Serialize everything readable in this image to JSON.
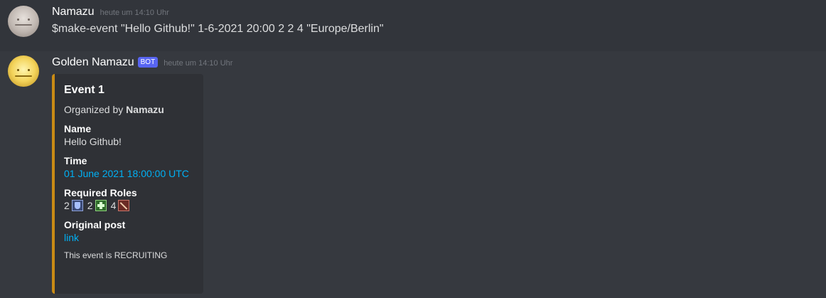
{
  "messages": [
    {
      "username": "Namazu",
      "timestamp": "heute um 14:10 Uhr",
      "content": "$make-event \"Hello Github!\" 1-6-2021 20:00 2 2 4 \"Europe/Berlin\""
    },
    {
      "username": "Golden Namazu",
      "bot_tag": "BOT",
      "timestamp": "heute um 14:10 Uhr",
      "embed": {
        "accent_color": "#c98b15",
        "title": "Event 1",
        "description_prefix": "Organized by",
        "description_name": "Namazu",
        "fields": {
          "name": {
            "label": "Name",
            "value": "Hello Github!"
          },
          "time": {
            "label": "Time",
            "value": "01 June 2021 18:00:00 UTC"
          },
          "roles": {
            "label": "Required Roles",
            "items": [
              {
                "count": "2",
                "icon": "tank-role-icon"
              },
              {
                "count": "2",
                "icon": "healer-role-icon"
              },
              {
                "count": "4",
                "icon": "dps-role-icon"
              }
            ]
          },
          "original_post": {
            "label": "Original post",
            "value": "link"
          }
        },
        "footer": "This event is RECRUITING"
      }
    }
  ],
  "colors": {
    "background": "#36393f",
    "highlight": "#32353b",
    "link": "#00b0f4",
    "bot_tag": "#5865f2"
  }
}
